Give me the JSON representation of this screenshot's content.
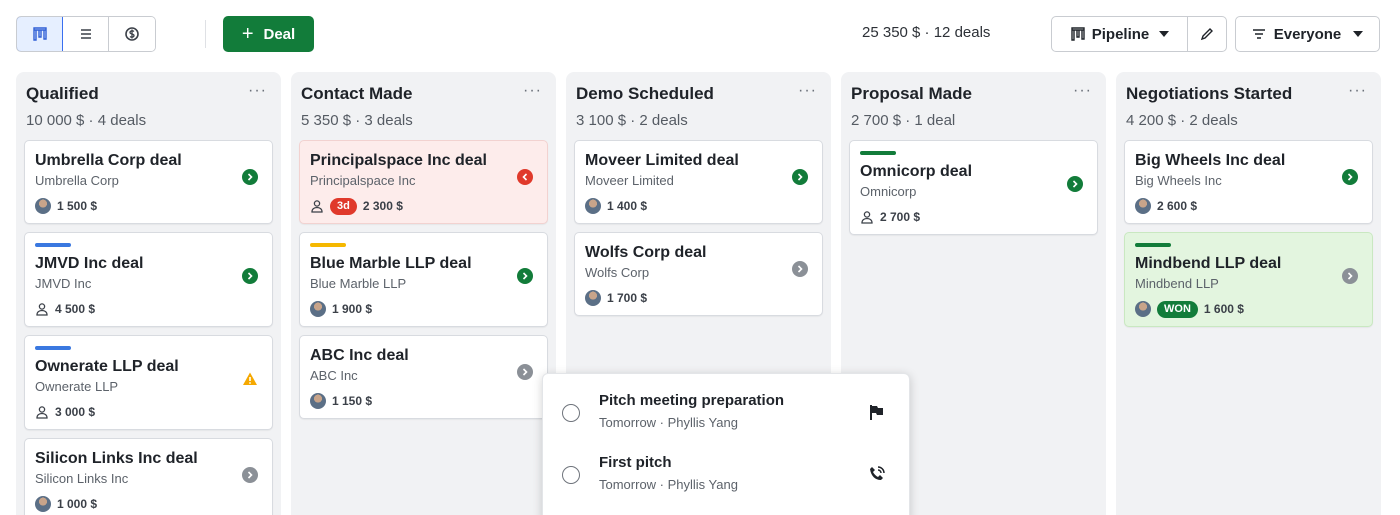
{
  "toolbar": {
    "views": [
      {
        "icon": "pipeline-view-icon",
        "active": true
      },
      {
        "icon": "list-view-icon",
        "active": false
      },
      {
        "icon": "forecast-view-icon",
        "active": false
      }
    ],
    "add_deal_label": "Deal",
    "summary": "25 350 $  ·  12 deals",
    "pipeline_label": "Pipeline",
    "filter_label": "Everyone"
  },
  "columns": [
    {
      "title": "Qualified",
      "meta": "10 000 $ · 4 deals",
      "cards": [
        {
          "title": "Umbrella Corp deal",
          "org": "Umbrella Corp",
          "value": "1 500 $",
          "owner": "avatar",
          "status": "go",
          "stripe": null,
          "bg": "white"
        },
        {
          "title": "JMVD Inc deal",
          "org": "JMVD Inc",
          "value": "4 500 $",
          "owner": "person",
          "status": "go",
          "stripe": "#3a78e0",
          "bg": "white"
        },
        {
          "title": "Ownerate LLP deal",
          "org": "Ownerate LLP",
          "value": "3 000 $",
          "owner": "person",
          "status": "warn",
          "stripe": "#3a78e0",
          "bg": "white"
        },
        {
          "title": "Silicon Links Inc deal",
          "org": "Silicon Links Inc",
          "value": "1 000 $",
          "owner": "avatar",
          "status": "gray",
          "stripe": null,
          "bg": "white"
        }
      ]
    },
    {
      "title": "Contact Made",
      "meta": "5 350 $ · 3 deals",
      "cards": [
        {
          "title": "Principalspace Inc deal",
          "org": "Principalspace Inc",
          "value": "2 300 $",
          "owner": "person",
          "badge": "3d",
          "status": "late",
          "stripe": null,
          "bg": "red"
        },
        {
          "title": "Blue Marble LLP deal",
          "org": "Blue Marble LLP",
          "value": "1 900 $",
          "owner": "avatar",
          "status": "go",
          "stripe": "#f5b800",
          "bg": "white"
        },
        {
          "title": "ABC Inc deal",
          "org": "ABC Inc",
          "value": "1 150 $",
          "owner": "avatar",
          "status": "gray",
          "stripe": null,
          "bg": "white"
        }
      ]
    },
    {
      "title": "Demo Scheduled",
      "meta": "3 100 $ · 2 deals",
      "cards": [
        {
          "title": "Moveer Limited deal",
          "org": "Moveer Limited",
          "value": "1 400 $",
          "owner": "avatar",
          "status": "go",
          "stripe": null,
          "bg": "white"
        },
        {
          "title": "Wolfs Corp deal",
          "org": "Wolfs Corp",
          "value": "1 700 $",
          "owner": "avatar",
          "status": "gray",
          "stripe": null,
          "bg": "white"
        }
      ]
    },
    {
      "title": "Proposal Made",
      "meta": "2 700 $ · 1 deal",
      "cards": [
        {
          "title": "Omnicorp deal",
          "org": "Omnicorp",
          "value": "2 700 $",
          "owner": "person",
          "status": "go",
          "stripe": "#127c3a",
          "bg": "white"
        }
      ]
    },
    {
      "title": "Negotiations Started",
      "meta": "4 200 $ · 2 deals",
      "cards": [
        {
          "title": "Big Wheels Inc deal",
          "org": "Big Wheels Inc",
          "value": "2 600 $",
          "owner": "avatar",
          "status": "go",
          "stripe": null,
          "bg": "white"
        },
        {
          "title": "Mindbend LLP deal",
          "org": "Mindbend LLP",
          "value": "1 600 $",
          "owner": "avatar",
          "badge_won": "WON",
          "status": "gray",
          "stripe": "#127c3a",
          "bg": "green"
        }
      ]
    }
  ],
  "popover": {
    "activities": [
      {
        "title": "Pitch meeting preparation",
        "sub": "Tomorrow · Phyllis Yang",
        "icon": "flag-icon"
      },
      {
        "title": "First pitch",
        "sub": "Tomorrow · Phyllis Yang",
        "icon": "phone-call-icon"
      }
    ]
  },
  "colors": {
    "accent_green": "#127c3a",
    "late_red": "#e0392b",
    "column_bg": "#f1f2f4"
  }
}
